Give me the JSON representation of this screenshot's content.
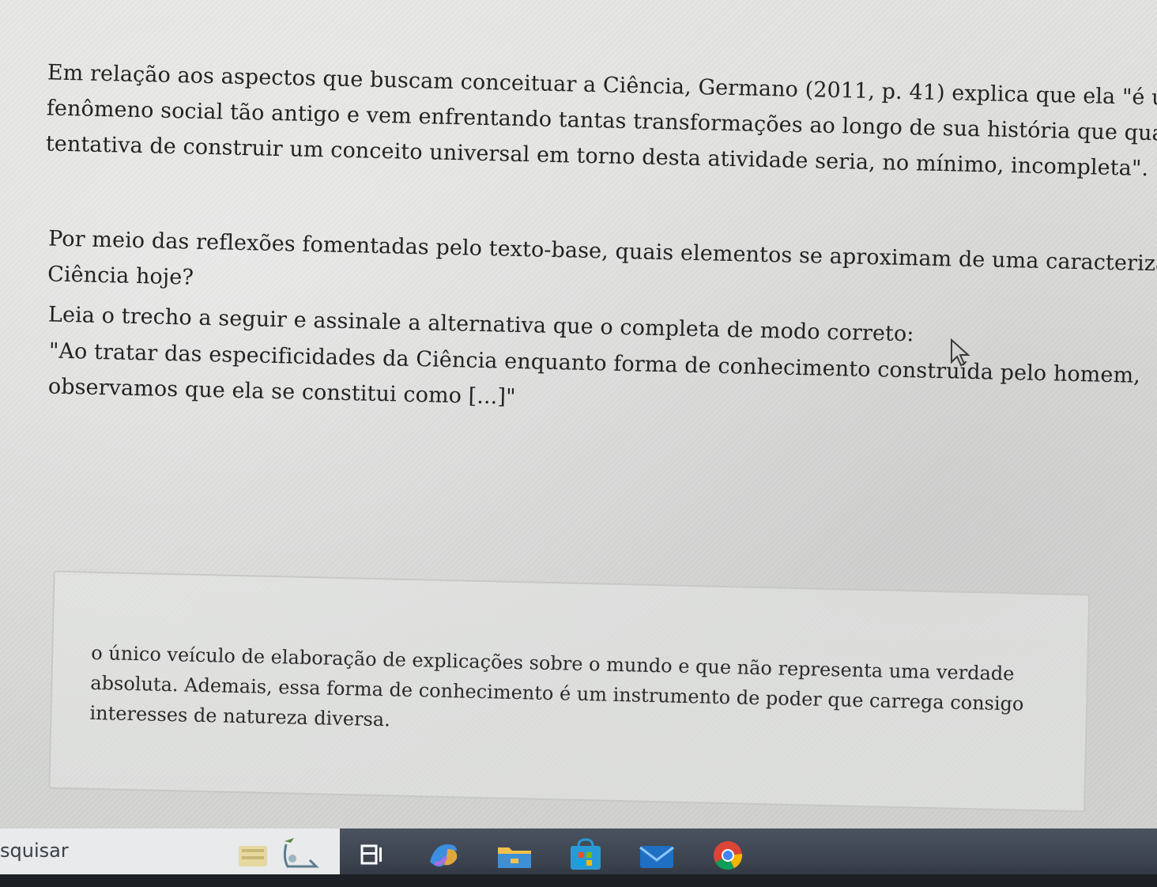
{
  "question": {
    "context_lines": [
      "Em relação aos aspectos que buscam conceituar a Ciência, Germano (2011, p. 41) explica que ela \"é um",
      "fenômeno social tão antigo e vem enfrentando tantas transformações ao longo de sua história que qualquer",
      "tentativa de construir um conceito universal em torno desta atividade seria, no mínimo, incompleta\"."
    ],
    "prompt_lines": [
      "Por meio das reflexões fomentadas pelo texto-base, quais elementos se aproximam de uma caracterização da",
      "Ciência hoje?"
    ],
    "instruction": "Leia o trecho a seguir e assinale a alternativa que o completa de modo correto:",
    "excerpt_lines": [
      "\"Ao tratar das especificidades da Ciência enquanto forma de conhecimento construída pelo homem,",
      "observamos que ela se constitui como [...]\""
    ]
  },
  "answer_option": {
    "lines": [
      "o único veículo de elaboração de explicações sobre o mundo e que não representa uma verdade",
      "absoluta. Ademais, essa forma de conhecimento é um instrumento de poder que carrega consigo",
      "interesses de natureza diversa."
    ]
  },
  "taskbar": {
    "search_placeholder": "squisar",
    "icons": [
      "task-view-icon",
      "copilot-icon",
      "file-explorer-icon",
      "store-icon",
      "mail-icon",
      "chrome-icon"
    ]
  }
}
